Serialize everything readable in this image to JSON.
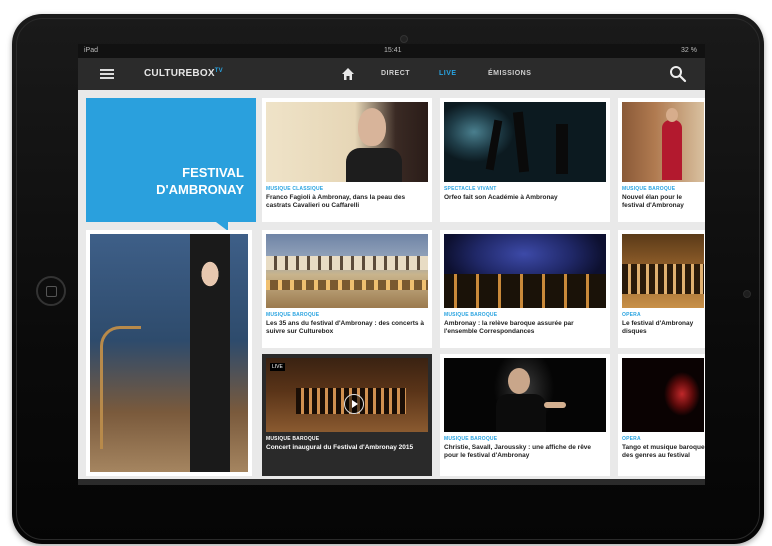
{
  "status": {
    "left": "iPad",
    "time": "15:41",
    "right": "32 %"
  },
  "nav": {
    "logo": "CULTUREBOX",
    "logo_tm": "TV",
    "items": [
      "DIRECT",
      "LIVE",
      "ÉMISSIONS"
    ]
  },
  "festival": {
    "line1": "FESTIVAL",
    "line2": "D'AMBRONAY"
  },
  "tiles": [
    {
      "category": "MUSIQUE CLASSIQUE",
      "title": "Franco Fagioli à Ambronay, dans la peau des castrats Cavalieri ou Caffarelli"
    },
    {
      "category": "SPECTACLE VIVANT",
      "title": "Orfeo fait son Académie à Ambronay"
    },
    {
      "category": "MUSIQUE BAROQUE",
      "title": "Nouvel élan pour le festival d'Ambronay"
    },
    {
      "category": "MUSIQUE BAROQUE",
      "title": "Les 35 ans du festival d'Ambronay : des concerts à suivre sur Culturebox"
    },
    {
      "category": "MUSIQUE BAROQUE",
      "title": "Ambronay : la relève baroque assurée par l'ensemble Correspondances"
    },
    {
      "category": "OPERA",
      "title": "Le festival d'Ambronay disques"
    },
    {
      "category": "MUSIQUE BAROQUE",
      "title": "Concert inaugural du Festival d'Ambronay 2015",
      "badge": "LIVE"
    },
    {
      "category": "MUSIQUE BAROQUE",
      "title": "Christie, Savall, Jaroussky : une affiche de rêve pour le festival d'Ambronay"
    },
    {
      "category": "OPERA",
      "title": "Tango et musique baroque des genres au festival"
    }
  ],
  "colors": {
    "accent": "#29a3e0",
    "nav_bg": "#2b2b2b"
  }
}
